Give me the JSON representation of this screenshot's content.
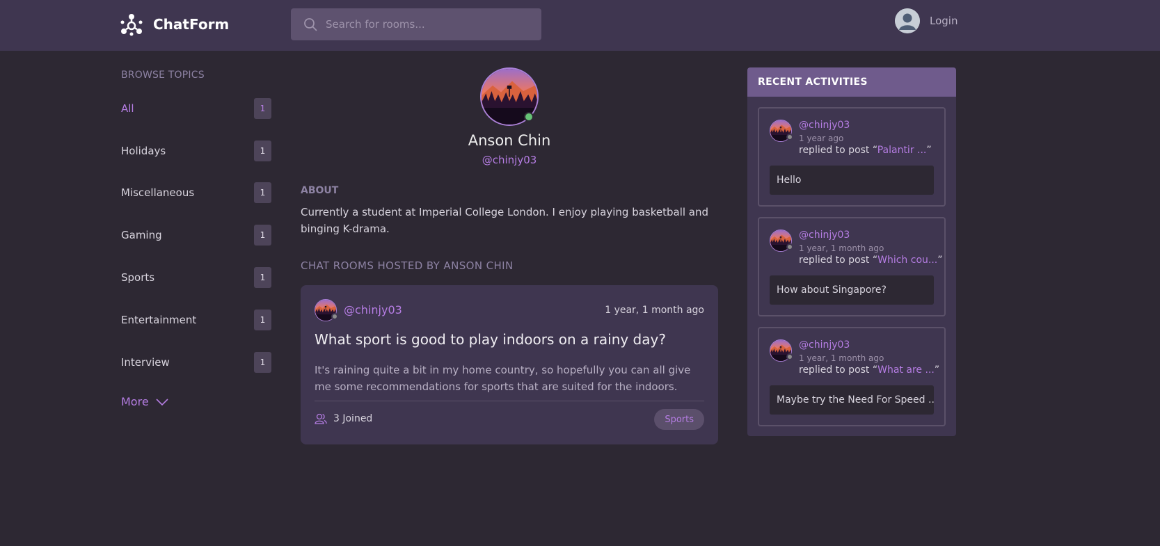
{
  "app": {
    "name": "ChatForm"
  },
  "search": {
    "placeholder": "Search for rooms..."
  },
  "auth": {
    "login_label": "Login"
  },
  "sidebar": {
    "title": "BROWSE TOPICS",
    "topics": [
      {
        "label": "All",
        "count": "1",
        "active": true
      },
      {
        "label": "Holidays",
        "count": "1"
      },
      {
        "label": "Miscellaneous",
        "count": "1"
      },
      {
        "label": "Gaming",
        "count": "1"
      },
      {
        "label": "Sports",
        "count": "1"
      },
      {
        "label": "Entertainment",
        "count": "1"
      },
      {
        "label": "Interview",
        "count": "1"
      }
    ],
    "more_label": "More"
  },
  "profile": {
    "name": "Anson Chin",
    "handle": "@chinjy03",
    "about_title": "ABOUT",
    "about_text": "Currently a student at Imperial College London. I enjoy playing basketball and binging K-drama.",
    "rooms_title": "CHAT ROOMS HOSTED BY ANSON CHIN"
  },
  "room": {
    "user": "@chinjy03",
    "time": "1 year, 1 month ago",
    "title": "What sport is good to play indoors on a rainy day?",
    "description": "It's raining quite a bit in my home country, so hopefully you can all give me some recommendations for sports that are suited for the indoors.",
    "joined": "3 Joined",
    "tag": "Sports"
  },
  "activities": {
    "title": "RECENT ACTIVITIES",
    "items": [
      {
        "user": "@chinjy03",
        "time": "1 year ago",
        "replied_prefix": "replied to post “",
        "post": "Palantir ...",
        "replied_suffix": "”",
        "message": "Hello"
      },
      {
        "user": "@chinjy03",
        "time": "1 year, 1 month ago",
        "replied_prefix": "replied to post “",
        "post": "Which cou...",
        "replied_suffix": "”",
        "message": "How about Singapore?"
      },
      {
        "user": "@chinjy03",
        "time": "1 year, 1 month ago",
        "replied_prefix": "replied to post “",
        "post": "What are ...",
        "replied_suffix": "”",
        "message": "Maybe try the Need For Speed ..."
      }
    ]
  },
  "colors": {
    "background": "#2d2833",
    "header": "#3f3650",
    "accent": "#b57de3",
    "card": "#3f3650",
    "activities_header": "#6f5b8c",
    "online": "#66c277"
  }
}
